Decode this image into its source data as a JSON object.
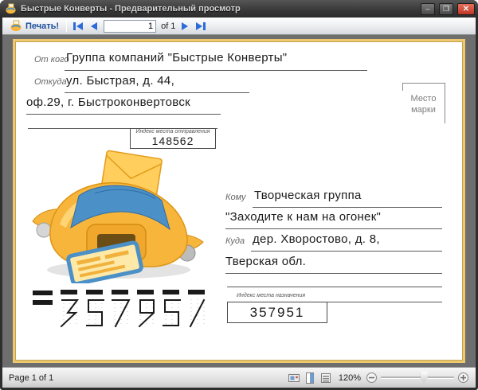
{
  "window": {
    "title": "Быстрые Конверты - Предварительный просмотр"
  },
  "window_controls": {
    "minimize": "–",
    "maximize": "❐",
    "close": "✕"
  },
  "toolbar": {
    "print_label": "Печать!",
    "page_value": "1",
    "of_label": "of 1"
  },
  "envelope": {
    "from_label": "От кого",
    "from_value": "Группа компаний \"Быстрые Конверты\"",
    "from_where_label": "Откуда",
    "from_where_value": "ул. Быстрая, д. 44,",
    "from_where_value2": "оф.29, г. Быстроконвертовск",
    "origin_index_label": "Индекс места отправления",
    "origin_index_value": "148562",
    "stamp_line1": "Место",
    "stamp_line2": "марки",
    "to_label": "Кому",
    "to_value": "Творческая группа",
    "to_value2": "\"Заходите к нам на огонек\"",
    "to_where_label": "Куда",
    "to_where_value": "дер. Хворостово, д. 8,",
    "to_where_value2": "Тверская обл.",
    "dest_index_label": "Индекс места назначения",
    "dest_index_value": "357951",
    "postal_code": "357951"
  },
  "statusbar": {
    "page_info": "Page 1 of 1",
    "zoom_level": "120%"
  },
  "colors": {
    "accent_blue": "#2d6cd8",
    "page_border_gold": "#ecc970",
    "printer_yellow": "#f7b53c",
    "printer_blue": "#4b90c6",
    "close_red": "#d9543f",
    "preview_bg": "#6e6e6e"
  }
}
